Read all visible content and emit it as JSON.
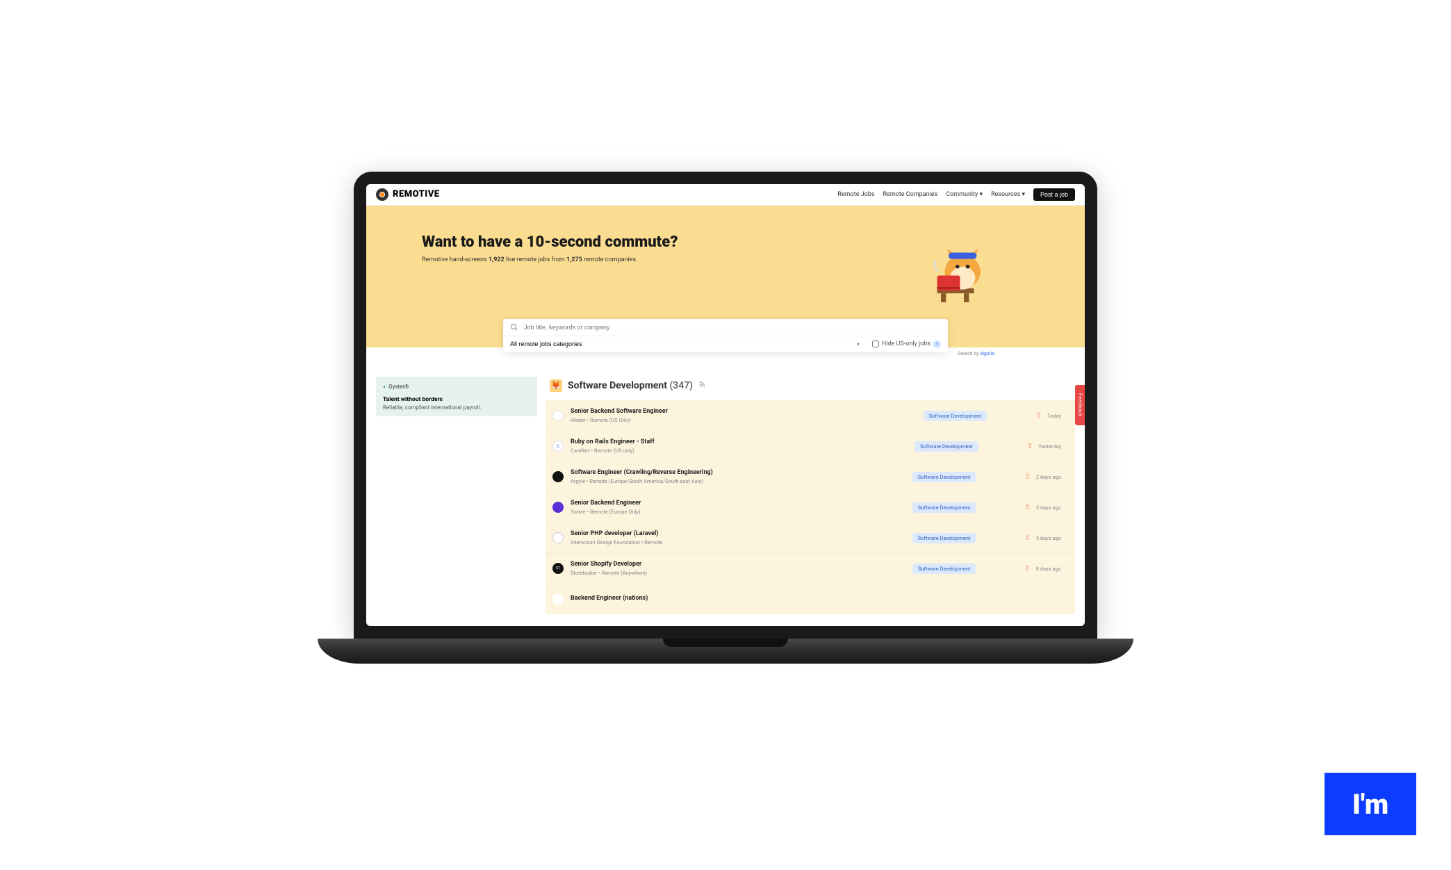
{
  "brand": "REMOTIVE",
  "nav": {
    "jobs": "Remote Jobs",
    "companies": "Remote Companies",
    "community": "Community",
    "resources": "Resources",
    "post": "Post a job"
  },
  "hero": {
    "title": "Want to have a 10-second commute?",
    "subtitle_pre": "Remotive hand-screens ",
    "job_count": "1,922",
    "subtitle_mid": " live remote jobs from ",
    "company_count": "1,275",
    "subtitle_post": " remote companies."
  },
  "search": {
    "placeholder": "Job title, keywords or company",
    "category": "All remote jobs categories",
    "hide_us_label": "Hide US-only jobs",
    "algolia_pre": "Search by ",
    "algolia_brand": "algolia"
  },
  "sponsor": {
    "name": "Oyster®",
    "headline": "Talent without borders",
    "sub": "Reliable, compliant international payroll."
  },
  "category": {
    "name": "Software Development",
    "count": "(347)"
  },
  "tag": "Software Development",
  "jobs": [
    {
      "title": "Senior Backend Software Engineer",
      "meta": "Aledor • Remote (US Only)",
      "time": "Today",
      "logo": "",
      "logoStyle": "background:#fff;border:1px solid #ddd"
    },
    {
      "title": "Ruby on Rails Engineer - Staff",
      "meta": "CareRev • Remote (US only)",
      "time": "Yesterday",
      "logo": "C",
      "logoStyle": "background:#fff;color:#2356c7;border:1px solid #ddd"
    },
    {
      "title": "Software Engineer (Crawling/Reverse Engineering)",
      "meta": "Argyle • Remote (Europe/South America/South-east Asia)",
      "time": "2 days ago",
      "logo": "",
      "logoStyle": "background:#111"
    },
    {
      "title": "Senior Backend Engineer",
      "meta": "Sorare • Remote (Europe Only)",
      "time": "3 days ago",
      "logo": "",
      "logoStyle": "background:#5b2fd6"
    },
    {
      "title": "Senior PHP developer (Laravel)",
      "meta": "Interaction Design Foundation • Remote",
      "time": "5 days ago",
      "logo": "",
      "logoStyle": "background:#fff;border:1px solid #ccc"
    },
    {
      "title": "Senior Shopify Developer",
      "meta": "Storetasker • Remote (Anywhere)",
      "time": "8 days ago",
      "logo": "ST",
      "logoStyle": "background:#111;font-size:5px"
    },
    {
      "title": "Backend Engineer (nations)",
      "meta": "",
      "time": "",
      "logo": "",
      "logoStyle": "background:#fff"
    }
  ],
  "feedback": "Feedback",
  "corner_badge": "I'm"
}
